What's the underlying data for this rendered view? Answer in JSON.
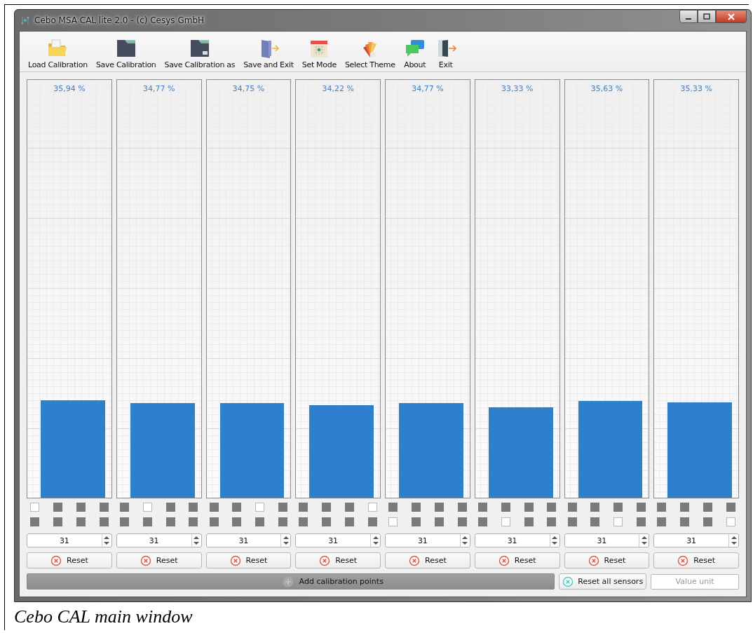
{
  "window": {
    "title": "Cebo MSA CAL lite 2.0 - (c) Cesys GmbH"
  },
  "toolbar": [
    {
      "kind": "folder",
      "label": "Load Calibration"
    },
    {
      "kind": "disk",
      "label": "Save Calibration"
    },
    {
      "kind": "disk-as",
      "label": "Save Calibration as"
    },
    {
      "kind": "door-arrow",
      "label": "Save and Exit"
    },
    {
      "kind": "calendar",
      "label": "Set Mode"
    },
    {
      "kind": "palette",
      "label": "Select Theme"
    },
    {
      "kind": "chat",
      "label": "About"
    },
    {
      "kind": "exit",
      "label": "Exit"
    }
  ],
  "sensors": [
    {
      "reading": "35,94 %",
      "level": 0.234,
      "indicators": [
        {
          "selected": true
        },
        {
          "selected": false
        },
        {
          "selected": false
        },
        {
          "selected": false
        },
        {
          "selected": false
        },
        {
          "selected": false
        },
        {
          "selected": false
        },
        {
          "selected": false
        }
      ],
      "value": "31",
      "reset": "Reset"
    },
    {
      "reading": "34,77 %",
      "level": 0.226,
      "indicators": [
        {
          "selected": false
        },
        {
          "selected": true
        },
        {
          "selected": false
        },
        {
          "selected": false
        },
        {
          "selected": false
        },
        {
          "selected": false
        },
        {
          "selected": false
        },
        {
          "selected": false
        }
      ],
      "value": "31",
      "reset": "Reset"
    },
    {
      "reading": "34,75 %",
      "level": 0.226,
      "indicators": [
        {
          "selected": false
        },
        {
          "selected": false
        },
        {
          "selected": true
        },
        {
          "selected": false
        },
        {
          "selected": false
        },
        {
          "selected": false
        },
        {
          "selected": false
        },
        {
          "selected": false
        }
      ],
      "value": "31",
      "reset": "Reset"
    },
    {
      "reading": "34,22 %",
      "level": 0.222,
      "indicators": [
        {
          "selected": false
        },
        {
          "selected": false
        },
        {
          "selected": false
        },
        {
          "selected": true
        },
        {
          "selected": false
        },
        {
          "selected": false
        },
        {
          "selected": false
        },
        {
          "selected": false
        }
      ],
      "value": "31",
      "reset": "Reset"
    },
    {
      "reading": "34,77 %",
      "level": 0.226,
      "indicators": [
        {
          "selected": false
        },
        {
          "selected": false
        },
        {
          "selected": false
        },
        {
          "selected": false
        },
        {
          "selected": true
        },
        {
          "selected": false
        },
        {
          "selected": false
        },
        {
          "selected": false
        }
      ],
      "value": "31",
      "reset": "Reset"
    },
    {
      "reading": "33,33 %",
      "level": 0.217,
      "indicators": [
        {
          "selected": false
        },
        {
          "selected": false
        },
        {
          "selected": false
        },
        {
          "selected": false
        },
        {
          "selected": false
        },
        {
          "selected": true
        },
        {
          "selected": false
        },
        {
          "selected": false
        }
      ],
      "value": "31",
      "reset": "Reset"
    },
    {
      "reading": "35,63 %",
      "level": 0.231,
      "indicators": [
        {
          "selected": false
        },
        {
          "selected": false
        },
        {
          "selected": false
        },
        {
          "selected": false
        },
        {
          "selected": false
        },
        {
          "selected": false
        },
        {
          "selected": true
        },
        {
          "selected": false
        }
      ],
      "value": "31",
      "reset": "Reset"
    },
    {
      "reading": "35,33 %",
      "level": 0.229,
      "indicators": [
        {
          "selected": false
        },
        {
          "selected": false
        },
        {
          "selected": false
        },
        {
          "selected": false
        },
        {
          "selected": false
        },
        {
          "selected": false
        },
        {
          "selected": false
        },
        {
          "selected": true
        }
      ],
      "value": "31",
      "reset": "Reset"
    }
  ],
  "add_button": "Add calibration points",
  "reset_all_button": "Reset all sensors",
  "value_unit": {
    "placeholder": "Value unit"
  },
  "caption": "Cebo CAL main window"
}
